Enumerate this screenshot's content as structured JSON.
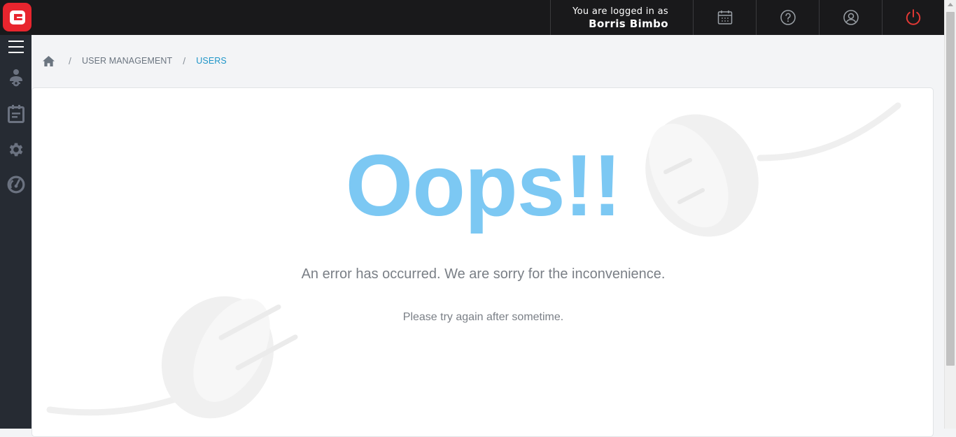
{
  "header": {
    "logged_in_label": "You are logged in as",
    "user_name": "Borris Bimbo",
    "buttons": [
      {
        "name": "calendar-icon"
      },
      {
        "name": "help-icon"
      },
      {
        "name": "profile-icon"
      },
      {
        "name": "power-icon",
        "color": "#e53935"
      }
    ]
  },
  "sidebar": {
    "items": [
      {
        "icon": "hamburger-menu-icon"
      },
      {
        "icon": "user-management-icon"
      },
      {
        "icon": "schedule-icon"
      },
      {
        "icon": "settings-gear-icon"
      },
      {
        "icon": "dashboard-gauge-icon"
      }
    ]
  },
  "breadcrumb": {
    "home_icon": "home-icon",
    "items": [
      "USER MANAGEMENT",
      "USERS"
    ]
  },
  "error": {
    "title": "Oops!!",
    "message": "An error has occurred. We are sorry for the inconvenience.",
    "hint": "Please try again after sometime."
  },
  "colors": {
    "topbar": "#19191b",
    "sidebar": "#262b33",
    "accent": "#7cc8f3",
    "breadcrumb_active": "#1e95c8",
    "logo": "#e8252e"
  }
}
